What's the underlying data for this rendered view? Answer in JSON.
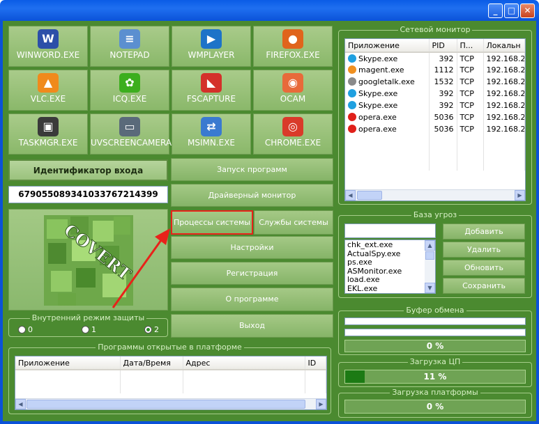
{
  "apps": [
    {
      "label": "WINWORD.EXE",
      "icon": "word-icon",
      "color": "#2c4fa8",
      "glyph": "W"
    },
    {
      "label": "NOTEPAD",
      "icon": "notepad-icon",
      "color": "#5b8fd0",
      "glyph": "≡"
    },
    {
      "label": "WMPLAYER",
      "icon": "media-player-icon",
      "color": "#1d73c8",
      "glyph": "▶"
    },
    {
      "label": "FIREFOX.EXE",
      "icon": "firefox-icon",
      "color": "#e0641c",
      "glyph": "●"
    },
    {
      "label": "VLC.EXE",
      "icon": "vlc-cone-icon",
      "color": "#f08a1c",
      "glyph": "▲"
    },
    {
      "label": "ICQ.EXE",
      "icon": "icq-flower-icon",
      "color": "#3cae1e",
      "glyph": "✿"
    },
    {
      "label": "FSCAPTURE",
      "icon": "fscapture-icon",
      "color": "#d4302a",
      "glyph": "◣"
    },
    {
      "label": "OCAM",
      "icon": "ocam-icon",
      "color": "#e86a3a",
      "glyph": "◉"
    },
    {
      "label": "TASKMGR.EXE",
      "icon": "task-manager-icon",
      "color": "#3a3a3a",
      "glyph": "▣"
    },
    {
      "label": "UVSCREENCAMERA",
      "icon": "screen-camera-icon",
      "color": "#5a6a7a",
      "glyph": "▭"
    },
    {
      "label": "MSIMN.EXE",
      "icon": "outlook-express-icon",
      "color": "#3a7ad0",
      "glyph": "⇄"
    },
    {
      "label": "CHROME.EXE",
      "icon": "chrome-icon",
      "color": "#d93a2a",
      "glyph": "◎"
    }
  ],
  "login": {
    "label": "Идентификатор входа",
    "value": "679055089341033767214399"
  },
  "logo": {
    "text": "COVERT"
  },
  "menu": {
    "launch": "Запуск программ",
    "driver": "Драйверный монитор",
    "processes": "Процессы системы",
    "services": "Службы системы",
    "settings": "Настройки",
    "registration": "Регистрация",
    "about": "О программе",
    "exit": "Выход"
  },
  "protection": {
    "title": "Внутренний режим защиты",
    "options": [
      "0",
      "1",
      "2"
    ],
    "selected": "2"
  },
  "open_programs": {
    "title": "Программы открытые в платформе",
    "columns": [
      "Приложение",
      "Дата/Время",
      "Адрес",
      "ID"
    ]
  },
  "network": {
    "title": "Сетевой монитор",
    "columns": [
      "Приложение",
      "PID",
      "П...",
      "Локальн"
    ],
    "rows": [
      {
        "icon": "skype-icon",
        "color": "#1fa0e0",
        "app": "Skype.exe",
        "pid": "392",
        "proto": "TCP",
        "local": "192.168.2("
      },
      {
        "icon": "magent-icon",
        "color": "#f09020",
        "app": "magent.exe",
        "pid": "1112",
        "proto": "TCP",
        "local": "192.168.2("
      },
      {
        "icon": "googletalk-icon",
        "color": "#8a8a8a",
        "app": "googletalk.exe",
        "pid": "1532",
        "proto": "TCP",
        "local": "192.168.2("
      },
      {
        "icon": "skype-icon",
        "color": "#1fa0e0",
        "app": "Skype.exe",
        "pid": "392",
        "proto": "TCP",
        "local": "192.168.2("
      },
      {
        "icon": "skype-icon",
        "color": "#1fa0e0",
        "app": "Skype.exe",
        "pid": "392",
        "proto": "TCP",
        "local": "192.168.2("
      },
      {
        "icon": "opera-icon",
        "color": "#e0201a",
        "app": "opera.exe",
        "pid": "5036",
        "proto": "TCP",
        "local": "192.168.2("
      },
      {
        "icon": "opera-icon",
        "color": "#e0201a",
        "app": "opera.exe",
        "pid": "5036",
        "proto": "TCP",
        "local": "192.168.2("
      }
    ]
  },
  "threats": {
    "title": "База угроз",
    "input": "",
    "items": [
      "chk_ext.exe",
      "ActualSpy.exe",
      "ps.exe",
      "ASMonitor.exe",
      "load.exe",
      "EKL.exe"
    ],
    "add": "Добавить",
    "delete": "Удалить",
    "refresh": "Обновить",
    "save": "Сохранить"
  },
  "clipboard": {
    "title": "Буфер обмена",
    "value": "0 %"
  },
  "cpu": {
    "title": "Загрузка ЦП",
    "value": "11 %",
    "fraction": 0.11
  },
  "platform": {
    "title": "Загрузка платформы",
    "value": "0 %"
  }
}
